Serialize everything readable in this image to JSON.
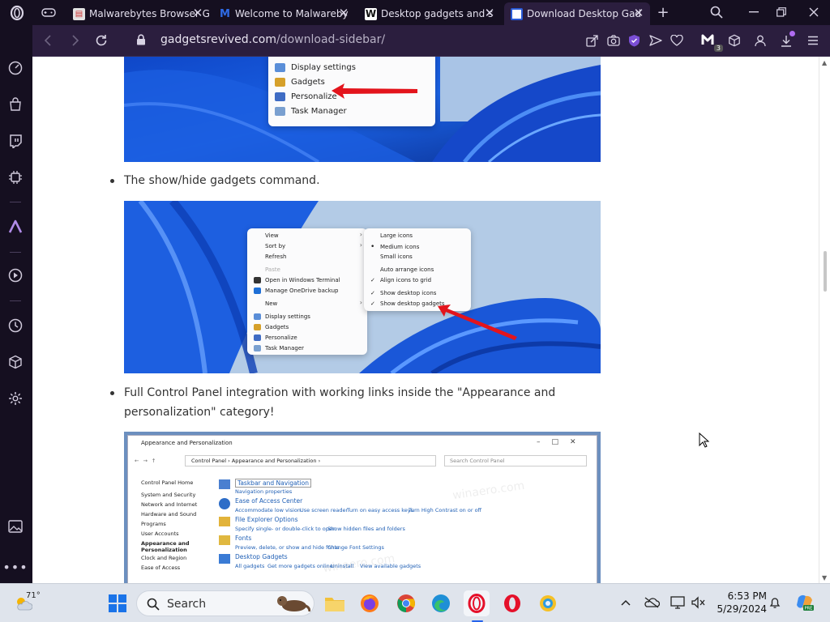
{
  "browser": {
    "tabs": [
      {
        "title": "Malwarebytes Browser G",
        "active": false,
        "favicon": "malwarebytes-page-icon"
      },
      {
        "title": "Welcome to Malwareby",
        "active": false,
        "favicon": "malwarebytes-m-icon"
      },
      {
        "title": "Desktop gadgets and s",
        "active": false,
        "favicon": "w-icon"
      },
      {
        "title": "Download Desktop Gad",
        "active": true,
        "favicon": "blue-page-icon"
      }
    ],
    "new_tab_label": "+",
    "close_glyph": "✕",
    "url_domain": "gadgetsrevived.com",
    "url_path": "/download-sidebar/",
    "extension_badge": "3",
    "accent": "#7b4fd6"
  },
  "article": {
    "shot1_menu": [
      {
        "label": "Display settings"
      },
      {
        "label": "Gadgets"
      },
      {
        "label": "Personalize"
      },
      {
        "label": "Task Manager"
      }
    ],
    "bullet1": "The show/hide gadgets command.",
    "shot2_menu": [
      {
        "label": "View",
        "arrow": "›"
      },
      {
        "label": "Sort by",
        "arrow": "›"
      },
      {
        "label": "Refresh",
        "arrow": ""
      },
      {
        "label": "Paste",
        "arrow": ""
      },
      {
        "label": "Open in Windows Terminal",
        "arrow": ""
      },
      {
        "label": "Manage OneDrive backup",
        "arrow": ""
      },
      {
        "label": "New",
        "arrow": "›"
      },
      {
        "label": "Display settings",
        "arrow": ""
      },
      {
        "label": "Gadgets",
        "arrow": ""
      },
      {
        "label": "Personalize",
        "arrow": ""
      },
      {
        "label": "Task Manager",
        "arrow": ""
      }
    ],
    "shot2_submenu": [
      {
        "label": "Large icons",
        "mark": ""
      },
      {
        "label": "Medium icons",
        "mark": "•"
      },
      {
        "label": "Small icons",
        "mark": ""
      },
      {
        "label": "Auto arrange icons",
        "mark": ""
      },
      {
        "label": "Align icons to grid",
        "mark": "✓"
      },
      {
        "label": "Show desktop icons",
        "mark": "✓"
      },
      {
        "label": "Show desktop gadgets",
        "mark": "✓"
      }
    ],
    "bullet2_line1": "Full Control Panel integration with working links inside the \"Appearance and",
    "bullet2_line2": "personalization\" category!",
    "cp": {
      "window_title": "Appearance and Personalization",
      "breadcrumb": "Control Panel  ›  Appearance and Personalization  ›",
      "search_placeholder": "Search Control Panel",
      "left_nav": [
        "Control Panel Home",
        "System and Security",
        "Network and Internet",
        "Hardware and Sound",
        "Programs",
        "User Accounts",
        "Appearance and Personalization",
        "Clock and Region",
        "Ease of Access"
      ],
      "sections": [
        {
          "title": "Taskbar and Navigation",
          "links": [
            "Navigation properties"
          ]
        },
        {
          "title": "Ease of Access Center",
          "links": [
            "Accommodate low vision",
            "Use screen reader",
            "Turn on easy access keys",
            "Turn High Contrast on or off"
          ]
        },
        {
          "title": "File Explorer Options",
          "links": [
            "Specify single- or double-click to open",
            "Show hidden files and folders"
          ]
        },
        {
          "title": "Fonts",
          "links": [
            "Preview, delete, or show and hide fonts",
            "Change Font Settings"
          ]
        },
        {
          "title": "Desktop Gadgets",
          "links": [
            "All gadgets",
            "Get more gadgets online",
            "Uninstall",
            "View available gadgets"
          ]
        }
      ],
      "watermark": "winaero.com"
    }
  },
  "taskbar": {
    "weather_temp": "71°",
    "search_label": "Search",
    "time": "6:53 PM",
    "date": "5/29/2024"
  }
}
